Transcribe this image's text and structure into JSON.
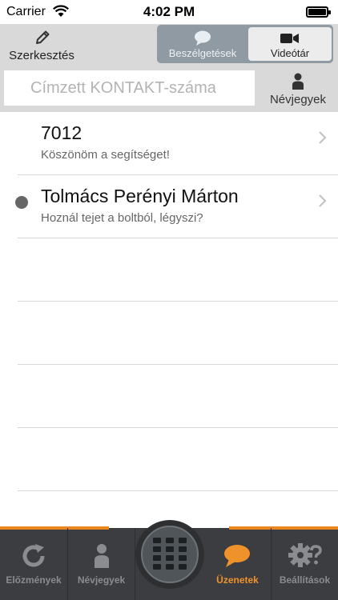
{
  "status_bar": {
    "carrier": "Carrier",
    "time": "4:02 PM",
    "battery_level": 1.0
  },
  "toolbar": {
    "edit_label": "Szerkesztés",
    "edit_icon": "pencil-icon",
    "segments": [
      {
        "label": "Beszélgetések",
        "icon": "speech-bubble-icon",
        "selected": false
      },
      {
        "label": "Videótár",
        "icon": "video-camera-icon",
        "selected": true
      }
    ]
  },
  "search": {
    "placeholder": "Címzett KONTAKT-száma",
    "value": "",
    "contacts_label": "Névjegyek",
    "contacts_icon": "person-icon"
  },
  "conversations": [
    {
      "name": "7012",
      "message": "Köszönöm a segítséget!",
      "unread": false
    },
    {
      "name": "Tolmács Perényi Márton",
      "message": "Hoznál tejet a boltból, légyszi?",
      "unread": true
    }
  ],
  "tab_bar": {
    "tabs": [
      {
        "label": "Előzmények",
        "icon": "history-icon",
        "active": false
      },
      {
        "label": "Névjegyek",
        "icon": "person-icon",
        "active": false
      },
      {
        "label": "",
        "icon": "keypad-icon",
        "active": false
      },
      {
        "label": "Üzenetek",
        "icon": "chat-bubble-icon",
        "active": true
      },
      {
        "label": "Beállítások",
        "icon": "settings-gear-icon",
        "active": false
      }
    ]
  },
  "colors": {
    "accent": "#f0922b",
    "tab_bar_bg": "#3b3d40",
    "toolbar_bg": "#d9d9d9",
    "segment_bg": "#8f9aa2",
    "unread_dot": "#666666"
  }
}
